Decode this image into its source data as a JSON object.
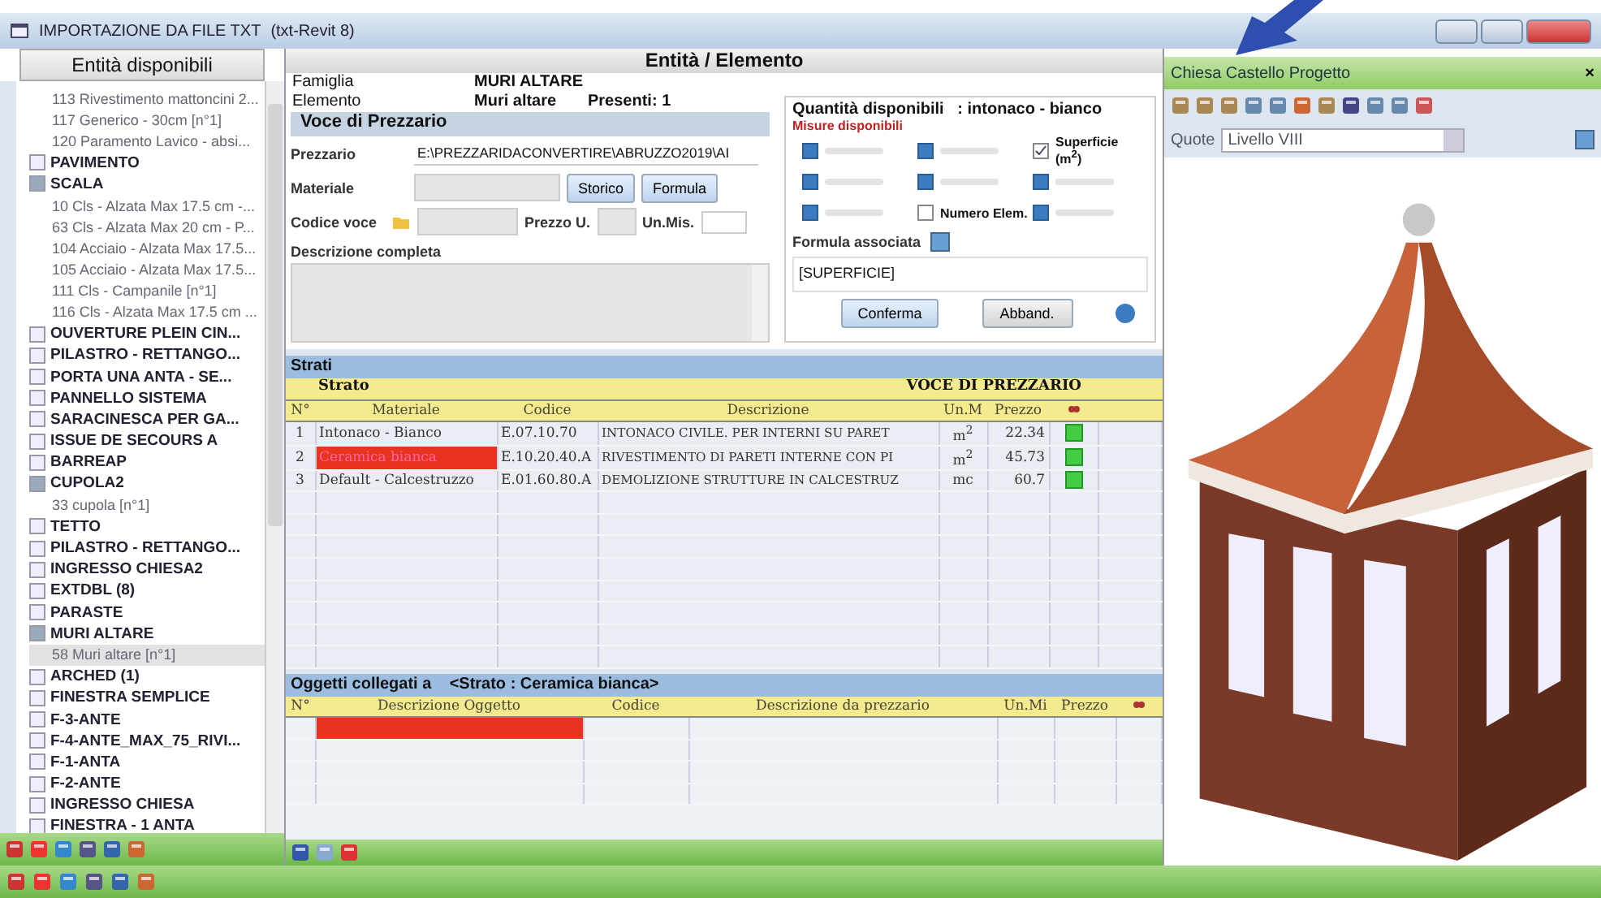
{
  "window": {
    "title": "IMPORTAZIONE DA FILE TXT",
    "subtitle": "(txt-Revit 8)"
  },
  "sidebar": {
    "title": "Entità disponibili",
    "continued_items": [
      "113 Rivestimento mattoncini 2...",
      "117 Generico - 30cm [n°1]",
      "120 Paramento Lavico - absi..."
    ],
    "tree": [
      {
        "label": "PAVIMENTO",
        "expanded": false
      },
      {
        "label": "SCALA",
        "expanded": true,
        "children": [
          {
            "label": "10 Cls - Alzata Max 17.5 cm -...",
            "selected": false
          },
          {
            "label": "63 Cls - Alzata Max 20 cm - P...",
            "selected": false
          },
          {
            "label": "104 Acciaio - Alzata Max 17.5...",
            "selected": false
          },
          {
            "label": "105 Acciaio - Alzata Max 17.5...",
            "selected": false
          },
          {
            "label": "111 Cls - Campanile [n°1]",
            "selected": false
          },
          {
            "label": "116 Cls - Alzata Max 17.5 cm ...",
            "selected": false
          }
        ]
      },
      {
        "label": "OUVERTURE PLEIN CIN...",
        "expanded": false
      },
      {
        "label": "PILASTRO - RETTANGO...",
        "expanded": false
      },
      {
        "label": "PORTA UNA ANTA - SE...",
        "expanded": false
      },
      {
        "label": "PANNELLO SISTEMA",
        "expanded": false
      },
      {
        "label": "SARACINESCA PER GA...",
        "expanded": false
      },
      {
        "label": "ISSUE DE SECOURS A",
        "expanded": false
      },
      {
        "label": "BARREAP",
        "expanded": false
      },
      {
        "label": "CUPOLA2",
        "expanded": true,
        "children": [
          {
            "label": "33 cupola [n°1]",
            "selected": false
          }
        ]
      },
      {
        "label": "TETTO",
        "expanded": false
      },
      {
        "label": "PILASTRO - RETTANGO...",
        "expanded": false
      },
      {
        "label": "INGRESSO CHIESA2",
        "expanded": false
      },
      {
        "label": "EXTDBL (8)",
        "expanded": false
      },
      {
        "label": "PARASTE",
        "expanded": false
      },
      {
        "label": "MURI ALTARE",
        "expanded": true,
        "children": [
          {
            "label": "58 Muri altare [n°1]",
            "selected": true
          }
        ]
      },
      {
        "label": "ARCHED (1)",
        "expanded": false
      },
      {
        "label": "FINESTRA SEMPLICE",
        "expanded": false
      },
      {
        "label": "F-3-ANTE",
        "expanded": false
      },
      {
        "label": "F-4-ANTE_MAX_75_RIVI...",
        "expanded": false
      },
      {
        "label": "F-1-ANTA",
        "expanded": false
      },
      {
        "label": "F-2-ANTE",
        "expanded": false
      },
      {
        "label": "INGRESSO CHIESA",
        "expanded": false
      },
      {
        "label": "FINESTRA - 1 ANTA",
        "expanded": false
      }
    ]
  },
  "entity": {
    "title": "Entità / Elemento",
    "famiglia_label": "Famiglia",
    "famiglia": "MURI ALTARE",
    "elemento_label": "Elemento",
    "elemento": "Muri altare",
    "presenti": "Presenti: 1"
  },
  "voce": {
    "title": "Voce di Prezzario",
    "prezzario_label": "Prezzario",
    "prezzario": "E:\\PREZZARIDACONVERTIRE\\ABRUZZO2019\\AI",
    "materiale_label": "Materiale",
    "storico": "Storico",
    "formula": "Formula",
    "codice_label": "Codice voce",
    "prezzo_label": "Prezzo U.",
    "unmis_label": "Un.Mis.",
    "descrizione_label": "Descrizione completa"
  },
  "quantita": {
    "title": "Quantità disponibili   : intonaco - bianco",
    "subtitle": "Misure disponibili",
    "measures": [
      {
        "checked": false,
        "disabled": true
      },
      {
        "checked": false,
        "disabled": true
      },
      {
        "label": "Superficie (m$^{2}$)",
        "checked": true,
        "disabled": false
      },
      {
        "checked": false,
        "disabled": true
      },
      {
        "checked": false,
        "disabled": true
      },
      {
        "checked": false,
        "disabled": true
      },
      {
        "checked": false,
        "disabled": true
      },
      {
        "label": "Numero Elem.",
        "checked": false,
        "disabled": false
      },
      {
        "checked": false,
        "disabled": true
      }
    ],
    "formula_label": "Formula associata",
    "formula": "[SUPERFICIE]",
    "confirm": "Conferma",
    "cancel": "Abband."
  },
  "strati": {
    "title": "Strati",
    "group_left": "Strato",
    "group_right": "VOCE DI PREZZARIO",
    "columns": [
      "N°",
      "Materiale",
      "Codice",
      "Descrizione",
      "Un.M",
      "Prezzo"
    ],
    "rows": [
      {
        "n": "1",
        "materiale": "Intonaco - Bianco",
        "codice": "E.07.10.70",
        "descrizione": "INTONACO CIVILE. PER INTERNI SU PARET",
        "um": "m$^{2}$",
        "prezzo": "22.34",
        "selected": false
      },
      {
        "n": "2",
        "materiale": "Ceramica bianca",
        "codice": "E.10.20.40.A",
        "descrizione": "RIVESTIMENTO DI PARETI INTERNE CON PI",
        "um": "m$^{2}$",
        "prezzo": "45.73",
        "selected": true
      },
      {
        "n": "3",
        "materiale": "Default - Calcestruzzo",
        "codice": "E.01.60.80.A",
        "descrizione": "DEMOLIZIONE STRUTTURE IN CALCESTRUZ",
        "um": "mc",
        "prezzo": "60.7",
        "selected": false
      }
    ]
  },
  "oggetti": {
    "title": "Oggetti collegati  a",
    "strato": "<Strato : Ceramica bianca>",
    "columns": [
      "N°",
      "Descrizione Oggetto",
      "Codice",
      "Descrizione da prezzario",
      "Un.Mi",
      "Prezzo"
    ],
    "rows": [
      {
        "selected": true
      }
    ]
  },
  "viewer": {
    "title": "Chiesa Castello Progetto",
    "close": "×",
    "quote_label": "Quote",
    "quote": "Livello VIII"
  }
}
